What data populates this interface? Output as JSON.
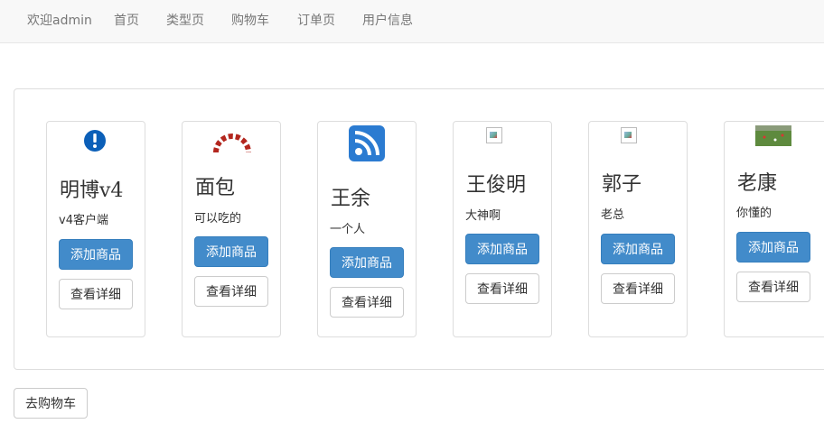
{
  "nav": {
    "items": [
      "欢迎admin",
      "首页",
      "类型页",
      "购物车",
      "订单页",
      "用户信息"
    ]
  },
  "products": [
    {
      "title": "明博v4",
      "desc": "v4客户端",
      "icon": "alert-circle-icon"
    },
    {
      "title": "面包",
      "desc": "可以吃的",
      "icon": "arch-logo-icon"
    },
    {
      "title": "王余",
      "desc": "一个人",
      "icon": "rss-feed-icon"
    },
    {
      "title": "王俊明",
      "desc": "大神啊",
      "icon": "broken-image-icon"
    },
    {
      "title": "郭子",
      "desc": "老总",
      "icon": "broken-image-icon"
    },
    {
      "title": "老康",
      "desc": "你懂的",
      "icon": "field-photo-icon"
    }
  ],
  "labels": {
    "add": "添加商品",
    "detail": "查看详细",
    "go_cart": "去购物车"
  },
  "colors": {
    "primary": "#428bca",
    "navbar_bg": "#f8f8f8"
  }
}
